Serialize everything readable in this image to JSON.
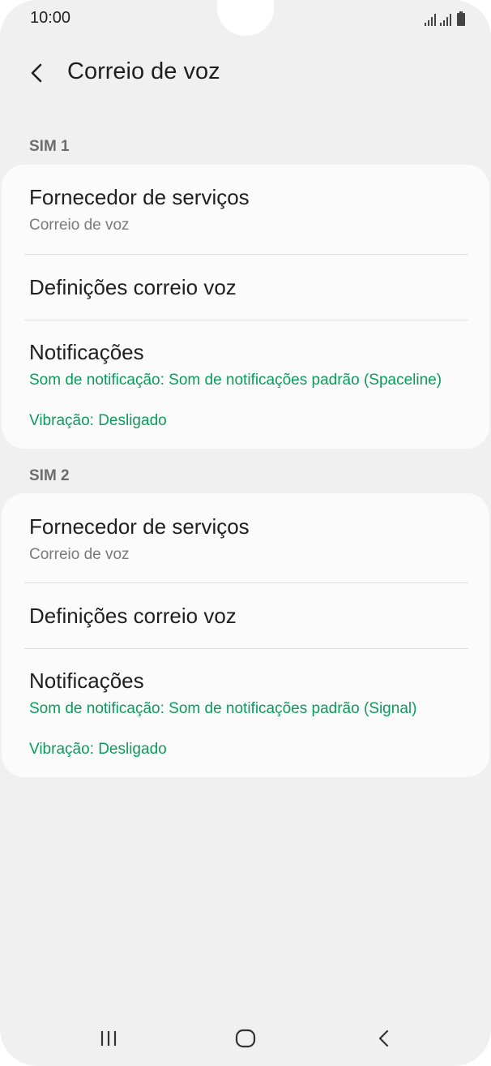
{
  "status_bar": {
    "time": "10:00"
  },
  "header": {
    "title": "Correio de voz"
  },
  "sim1": {
    "label": "SIM 1",
    "provider": {
      "title": "Fornecedor de serviços",
      "subtitle": "Correio de voz"
    },
    "settings": {
      "title": "Definições correio voz"
    },
    "notifications": {
      "title": "Notificações",
      "sound": "Som de notificação: Som de notificações padrão (Spaceline)",
      "vibration": "Vibração: Desligado"
    }
  },
  "sim2": {
    "label": "SIM 2",
    "provider": {
      "title": "Fornecedor de serviços",
      "subtitle": "Correio de voz"
    },
    "settings": {
      "title": "Definições correio voz"
    },
    "notifications": {
      "title": "Notificações",
      "sound": "Som de notificação: Som de notificações padrão (Signal)",
      "vibration": "Vibração: Desligado"
    }
  },
  "icons": {
    "back": "back-arrow-icon",
    "recents": "recents-icon",
    "home": "home-icon",
    "nav_back": "nav-back-icon"
  },
  "colors": {
    "background": "#f0f0f0",
    "card": "#fbfbfb",
    "accent_green": "#0c9b5c"
  }
}
